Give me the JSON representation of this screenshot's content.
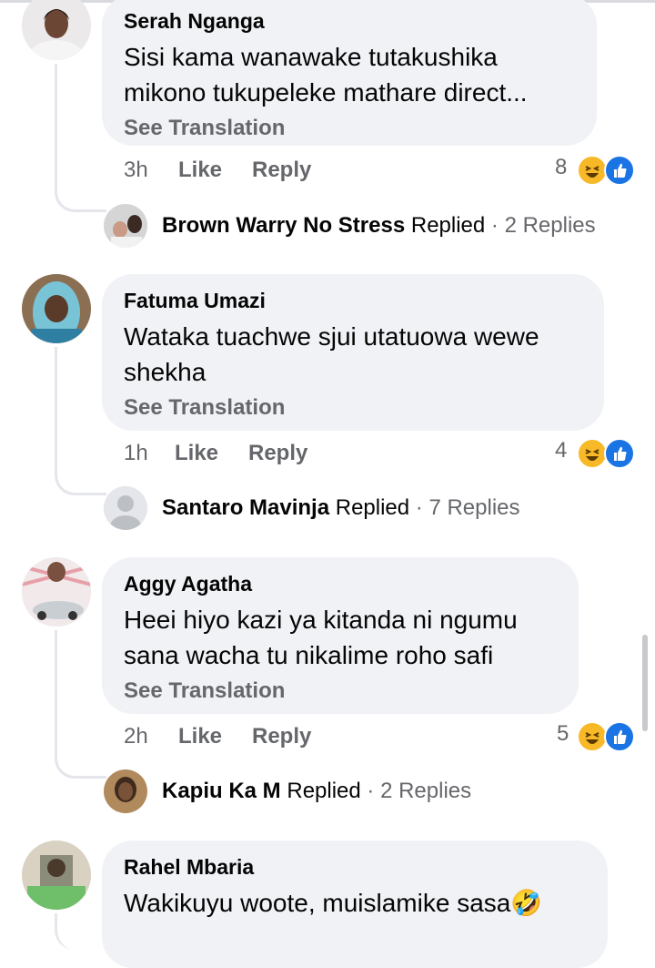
{
  "comments": [
    {
      "author": "Serah Nganga",
      "text_line1": "Sisi kama wanawake tutakushika",
      "text_line2": "mikono tukupeleke mathare direct...",
      "see_translation": "See Translation",
      "time": "3h",
      "like": "Like",
      "reply": "Reply",
      "reaction_count": "8",
      "reactions": [
        "haha-icon",
        "like-icon"
      ],
      "replier": "Brown Warry No Stress",
      "replied": "Replied",
      "reply_count": "· 2 Replies"
    },
    {
      "author": "Fatuma Umazi",
      "text_line1": "Wataka tuachwe sjui utatuowa wewe",
      "text_line2": "shekha",
      "see_translation": "See Translation",
      "time": "1h",
      "like": "Like",
      "reply": "Reply",
      "reaction_count": "4",
      "reactions": [
        "haha-icon",
        "like-icon"
      ],
      "replier": "Santaro Mavinja",
      "replied": "Replied",
      "reply_count": "· 7 Replies"
    },
    {
      "author": "Aggy Agatha",
      "text_line1": "Heei hiyo kazi ya kitanda ni ngumu",
      "text_line2": "sana wacha tu nikalime roho safi",
      "see_translation": "See Translation",
      "time": "2h",
      "like": "Like",
      "reply": "Reply",
      "reaction_count": "5",
      "reactions": [
        "haha-icon",
        "like-icon"
      ],
      "replier": "Kapiu Ka M",
      "replied": "Replied",
      "reply_count": "· 2 Replies"
    },
    {
      "author": "Rahel Mbaria",
      "text_line1": "Wakikuyu woote, muislamike sasa🤣"
    }
  ],
  "colors": {
    "bubble": "#f0f2f5",
    "secondary_text": "#65676b",
    "haha": "#f7b928",
    "like_blue": "#1b74e4"
  }
}
